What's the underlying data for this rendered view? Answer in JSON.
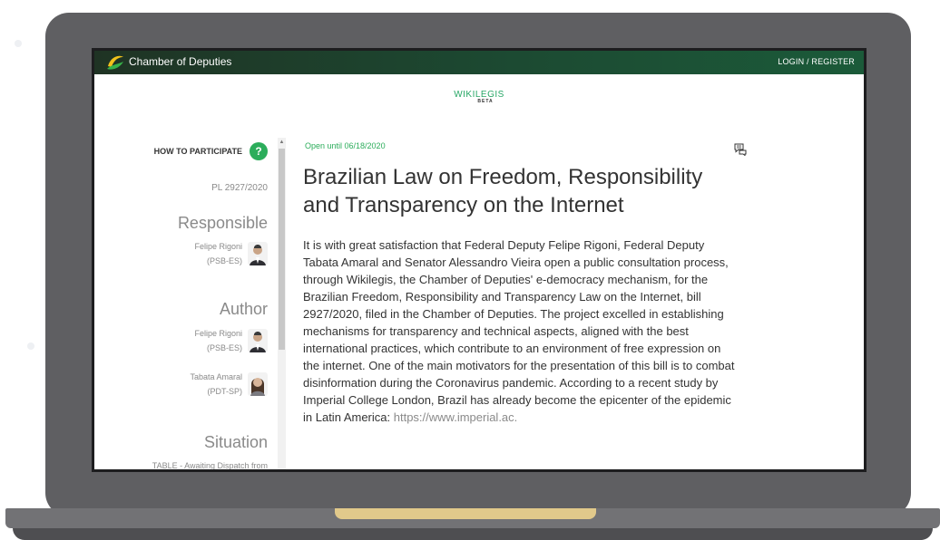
{
  "app": {
    "title": "Chamber of Deputies",
    "login_label": "LOGIN / REGISTER",
    "logo_icon": "chamber-logo-icon"
  },
  "wikilegis": {
    "name": "WIKILEGIS",
    "beta": "BETA"
  },
  "sidebar": {
    "how_to_participate": "HOW TO PARTICIPATE",
    "help_symbol": "?",
    "bill_number": "PL 2927/2020",
    "responsible_title": "Responsible",
    "responsible": [
      {
        "name": "Felipe Rigoni",
        "party": "(PSB-ES)"
      }
    ],
    "author_title": "Author",
    "authors": [
      {
        "name": "Felipe Rigoni",
        "party": "(PSB-ES)"
      },
      {
        "name": "Tabata Amaral",
        "party": "(PDT-SP)"
      }
    ],
    "situation_title": "Situation",
    "situation_detail": "TABLE - Awaiting Dispatch from"
  },
  "bill": {
    "open_until": "Open until 06/18/2020",
    "title": "Brazilian Law on Freedom, Responsibility and Transparency on the Internet",
    "body": "It is with great satisfaction that Federal Deputy Felipe Rigoni, Federal Deputy Tabata Amaral and Senator Alessandro Vieira open a public consultation process, through Wikilegis, the Chamber of Deputies' e-democracy mechanism, for the Brazilian Freedom, Responsibility and Transparency Law on the Internet, bill 2927/2020, filed in the Chamber of Deputies. The project excelled in establishing mechanisms for transparency and technical aspects, aligned with the best international practices, which contribute to an environment of free expression on the internet. One of the main motivators for the presentation of this bill is to combat disinformation during the Coronavirus pandemic. According to a recent study by Imperial College London, Brazil has already become the epicenter of the epidemic in Latin America:",
    "link": "https://www.imperial.ac."
  },
  "colors": {
    "accent_green": "#2cad5b",
    "topbar_dark": "#1f3324",
    "laptop_frame": "#5f5f62"
  }
}
